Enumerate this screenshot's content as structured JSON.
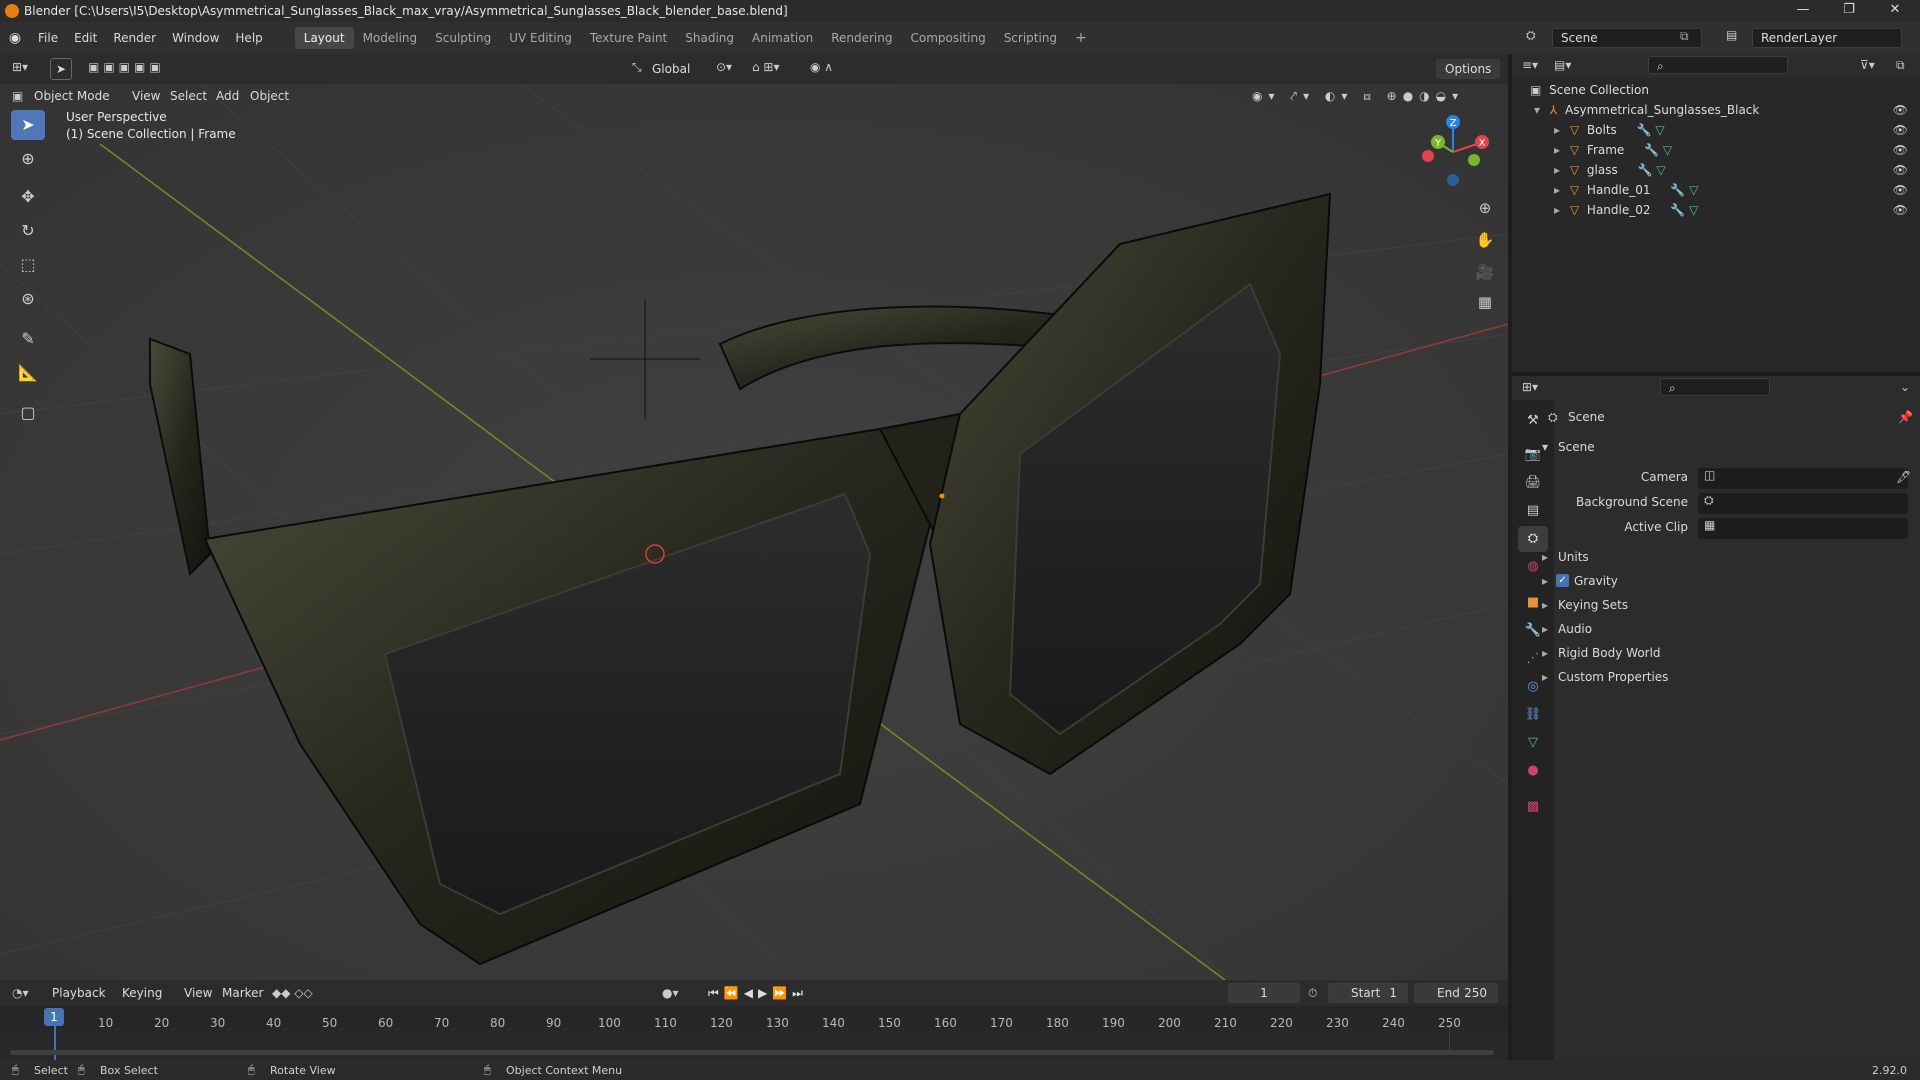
{
  "title": "Blender [C:\\Users\\I5\\Desktop\\Asymmetrical_Sunglasses_Black_max_vray/Asymmetrical_Sunglasses_Black_blender_base.blend]",
  "menus": [
    "File",
    "Edit",
    "Render",
    "Window",
    "Help"
  ],
  "workspaces": [
    "Layout",
    "Modeling",
    "Sculpting",
    "UV Editing",
    "Texture Paint",
    "Shading",
    "Animation",
    "Rendering",
    "Compositing",
    "Scripting"
  ],
  "scene": "Scene",
  "view_layer": "RenderLayer",
  "header": {
    "orientation": "Global",
    "options": "Options"
  },
  "viewport_header": {
    "mode": "Object Mode",
    "view": "View",
    "select": "Select",
    "add": "Add",
    "object": "Object"
  },
  "overlay": {
    "perspective": "User Perspective",
    "context": "(1) Scene Collection | Frame"
  },
  "gizmo": {
    "x": "X",
    "y": "Y",
    "z": "Z"
  },
  "outliner": {
    "root": "Scene Collection",
    "collection": "Asymmetrical_Sunglasses_Black",
    "objects": [
      "Bolts",
      "Frame",
      "glass",
      "Handle_01",
      "Handle_02"
    ]
  },
  "properties": {
    "breadcrumb": "Scene",
    "panel": "Scene",
    "camera_label": "Camera",
    "background_label": "Background Scene",
    "clip_label": "Active Clip",
    "units": "Units",
    "gravity": "Gravity",
    "keying_sets": "Keying Sets",
    "audio": "Audio",
    "rigid_body": "Rigid Body World",
    "custom": "Custom Properties"
  },
  "timeline": {
    "playback": "Playback",
    "keying": "Keying",
    "view": "View",
    "marker": "Marker",
    "current_frame": "1",
    "start_label": "Start",
    "start": "1",
    "end_label": "End",
    "end": "250",
    "ticks": [
      "10",
      "20",
      "30",
      "40",
      "50",
      "60",
      "70",
      "80",
      "90",
      "100",
      "110",
      "120",
      "130",
      "140",
      "150",
      "160",
      "170",
      "180",
      "190",
      "200",
      "210",
      "220",
      "230",
      "240",
      "250"
    ]
  },
  "status": {
    "select": "Select",
    "box_select": "Box Select",
    "rotate": "Rotate View",
    "context_menu": "Object Context Menu",
    "version": "2.92.0"
  },
  "colors": {
    "accent": "#5077b8",
    "object": "#e8903a",
    "mesh": "#4fbf8f",
    "x_axis": "#e2434e",
    "y_axis": "#7cb52b",
    "z_axis": "#2b85e0"
  }
}
